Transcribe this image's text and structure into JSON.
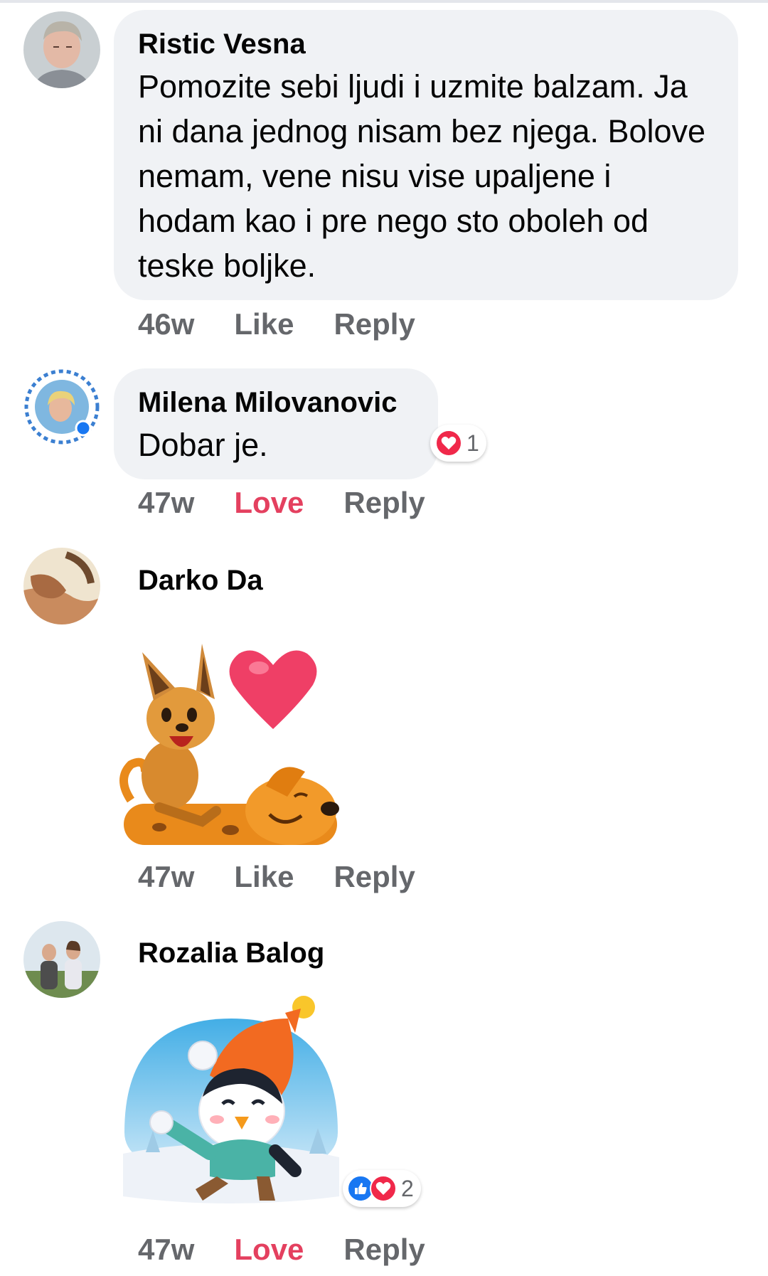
{
  "comments": [
    {
      "author": "Ristic Vesna",
      "text": "Pomozite sebi ljudi i uzmite balzam. Ja ni dana jednog nisam bez njega. Bolove nemam, vene nisu vise upaljene i hodam kao i pre nego sto oboleh od teske boljke.",
      "time": "46w",
      "like_label": "Like",
      "reply_label": "Reply"
    },
    {
      "author": "Milena Milovanovic",
      "text": "Dobar je.",
      "time": "47w",
      "like_label": "Love",
      "reply_label": "Reply",
      "reactions": {
        "count": "1",
        "icons": [
          "heart-icon"
        ]
      }
    },
    {
      "author": "Darko Da",
      "sticker": "cat-and-dog-heart-sticker",
      "time": "47w",
      "like_label": "Like",
      "reply_label": "Reply"
    },
    {
      "author": "Rozalia Balog",
      "sticker": "penguin-snowball-sticker",
      "time": "47w",
      "like_label": "Love",
      "reply_label": "Reply",
      "reactions": {
        "count": "2",
        "icons": [
          "thumbs-up-icon",
          "heart-icon"
        ]
      }
    }
  ],
  "colors": {
    "bubble": "#f0f2f5",
    "action_text": "#65676b",
    "love": "#e4405f",
    "like_blue": "#1877f2",
    "heart_red": "#f0284a"
  }
}
